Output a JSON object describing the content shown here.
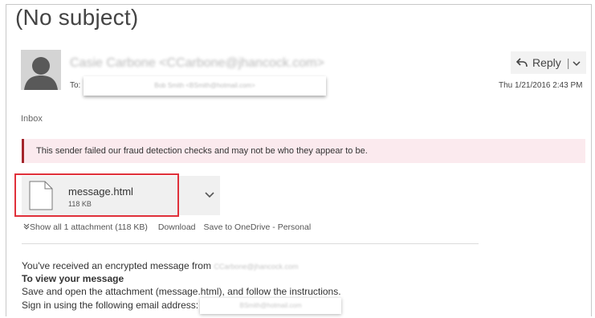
{
  "message": {
    "subject": "(No subject)",
    "sender": "Casie Carbone <CCarbone@jhancock.com>",
    "to_label": "To:",
    "to_value": "Bob Smith <BSmith@hotmail.com>",
    "date": "Thu 1/21/2016 2:43 PM",
    "folder": "Inbox"
  },
  "actions": {
    "reply_label": "Reply",
    "reply_separator": "|"
  },
  "warning": {
    "text": "This sender failed our fraud detection checks and may not be who they appear to be."
  },
  "attachment": {
    "name": "message.html",
    "size": "118 KB",
    "show_all": "Show all 1 attachment (118 KB)",
    "download": "Download",
    "save_to_onedrive": "Save to OneDrive - Personal"
  },
  "body": {
    "line1": "You've received an encrypted message from",
    "line1_sender": "CCarbone@jhancock.com",
    "heading": "To view your message",
    "line2": "Save and open the attachment (message.html), and follow the instructions.",
    "line3": "Sign in using the following email address:",
    "line3_email": "BSmith@hotmail.com"
  },
  "colors": {
    "warning_bg": "#fbeaee",
    "warning_accent": "#a4262c",
    "highlight_border": "#e0303a"
  },
  "icons": [
    "avatar-icon",
    "reply-icon",
    "chevron-down-icon",
    "file-icon"
  ]
}
